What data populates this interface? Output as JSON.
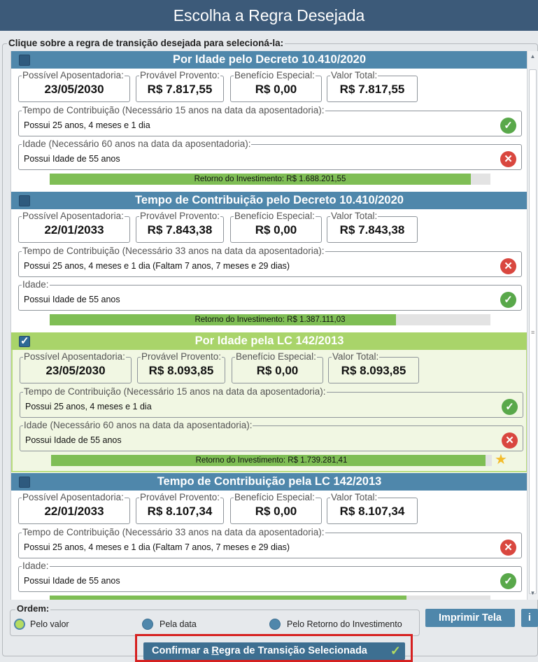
{
  "window": {
    "title": "Escolha a Regra Desejada"
  },
  "instruction": "Clique sobre a regra de transição desejada para selecioná-la:",
  "field_labels": {
    "possivel": "Possível Aposentadoria:",
    "provavel": "Provável Provento:",
    "beneficio": "Benefício Especial:",
    "valor": "Valor Total:"
  },
  "rules": [
    {
      "title": "Por Idade pelo Decreto 10.410/2020",
      "selected": false,
      "possivel_aposentadoria": "23/05/2030",
      "provavel_provento": "R$ 7.817,55",
      "beneficio_especial": "R$ 0,00",
      "valor_total": "R$ 7.817,55",
      "tempo_label": "Tempo de Contribuição (Necessário 15 anos na data da aposentadoria):",
      "tempo_text": "Possui 25 anos, 4 meses e 1 dia",
      "tempo_status": "check-icon",
      "idade_label": "Idade (Necessário 60 anos na data da aposentadoria):",
      "idade_text": "Possui Idade de 55 anos",
      "idade_status": "cross-icon",
      "retorno": "Retorno do Investimento: R$ 1.688.201,55",
      "retorno_fraction": 0.955,
      "best": false
    },
    {
      "title": "Tempo de Contribuição pelo Decreto 10.410/2020",
      "selected": false,
      "possivel_aposentadoria": "22/01/2033",
      "provavel_provento": "R$ 7.843,38",
      "beneficio_especial": "R$ 0,00",
      "valor_total": "R$ 7.843,38",
      "tempo_label": "Tempo de Contribuição (Necessário 33 anos na data da aposentadoria):",
      "tempo_text": "Possui 25 anos, 4 meses e 1 dia (Faltam 7 anos, 7 meses e 29 dias)",
      "tempo_status": "cross-icon",
      "idade_label": "Idade:",
      "idade_text": "Possui Idade de 55 anos",
      "idade_status": "check-icon",
      "retorno": "Retorno do Investimento: R$ 1.387.111,03",
      "retorno_fraction": 0.785,
      "best": false
    },
    {
      "title": "Por Idade pela LC 142/2013",
      "selected": true,
      "possivel_aposentadoria": "23/05/2030",
      "provavel_provento": "R$ 8.093,85",
      "beneficio_especial": "R$ 0,00",
      "valor_total": "R$ 8.093,85",
      "tempo_label": "Tempo de Contribuição (Necessário 15 anos na data da aposentadoria):",
      "tempo_text": "Possui 25 anos, 4 meses e 1 dia",
      "tempo_status": "check-icon",
      "idade_label": "Idade (Necessário 60 anos na data da aposentadoria):",
      "idade_text": "Possui Idade de 55 anos",
      "idade_status": "cross-icon",
      "retorno": "Retorno do Investimento: R$ 1.739.281,41",
      "retorno_fraction": 0.985,
      "best": true
    },
    {
      "title": "Tempo de Contribuição pela LC 142/2013",
      "selected": false,
      "possivel_aposentadoria": "22/01/2033",
      "provavel_provento": "R$ 8.107,34",
      "beneficio_especial": "R$ 0,00",
      "valor_total": "R$ 8.107,34",
      "tempo_label": "Tempo de Contribuição (Necessário 33 anos na data da aposentadoria):",
      "tempo_text": "Possui 25 anos, 4 meses e 1 dia (Faltam 7 anos, 7 meses e 29 dias)",
      "tempo_status": "cross-icon",
      "idade_label": "Idade:",
      "idade_text": "Possui Idade de 55 anos",
      "idade_status": "check-icon",
      "retorno": "",
      "retorno_fraction": 0.81,
      "best": false
    }
  ],
  "ordem": {
    "label": "Ordem:",
    "options": [
      "Pelo valor",
      "Pela data",
      "Pelo Retorno do Investimento"
    ],
    "selected": "Pelo valor"
  },
  "buttons": {
    "print": "Imprimir Tela",
    "info": "i",
    "confirm_pre": "Confirmar a ",
    "confirm_u": "R",
    "confirm_post": "egra de Transição Selecionada"
  },
  "colors": {
    "header": "#4f87ab",
    "header_selected": "#a9d46a",
    "ok": "#59a84a",
    "error": "#d9473f",
    "bar": "#7fbe55",
    "highlight": "#d62020"
  }
}
